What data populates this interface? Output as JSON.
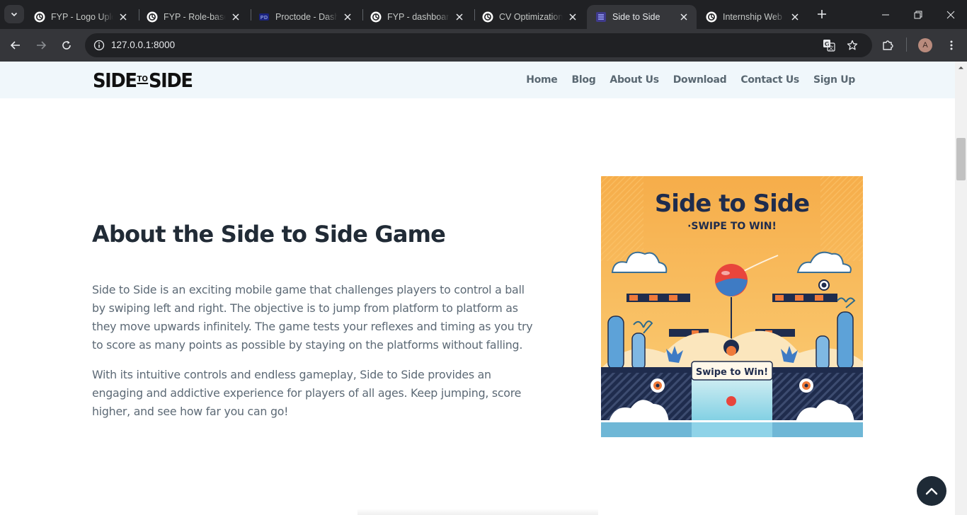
{
  "browser": {
    "tabs": [
      {
        "title": "FYP - Logo Upload",
        "favicon": "chatgpt-icon"
      },
      {
        "title": "FYP - Role-based",
        "favicon": "chatgpt-icon"
      },
      {
        "title": "Proctode - Dashboard",
        "favicon": "proctode-icon"
      },
      {
        "title": "FYP - dashboard",
        "favicon": "chatgpt-icon"
      },
      {
        "title": "CV Optimization",
        "favicon": "chatgpt-icon"
      },
      {
        "title": "Side to Side",
        "favicon": "site-icon",
        "active": true
      },
      {
        "title": "Internship Web Dev",
        "favicon": "chatgpt-icon"
      }
    ],
    "url": "127.0.0.1:8000",
    "profile_initial": "A"
  },
  "site": {
    "logo": {
      "left": "SIDE",
      "middle": "TO",
      "right": "SIDE"
    },
    "nav": [
      "Home",
      "Blog",
      "About Us",
      "Download",
      "Contact Us",
      "Sign Up"
    ]
  },
  "about": {
    "title": "About the Side to Side Game",
    "paragraphs": [
      "Side to Side is an exciting mobile game that challenges players to control a ball by swiping left and right. The objective is to jump from platform to platform as they move upwards infinitely. The game tests your reflexes and timing as you try to score as many points as possible by staying on the platforms without falling.",
      "With its intuitive controls and endless gameplay, Side to Side provides an engaging and addictive experience for players of all ages. Keep jumping, score higher, and see how far you can go!"
    ]
  },
  "poster": {
    "title": "Side to Side",
    "subtitle": "·SWIPE TO WIN!",
    "banner": "Swipe to Win!",
    "colors": {
      "background": "#f7b955",
      "navy": "#1f2c4d",
      "orange": "#ef7a3a",
      "red": "#e8453c",
      "sky": "#8fd3e8"
    }
  },
  "colors": {
    "header_bg": "#f0f7fb",
    "title": "#212b36",
    "body_text": "#5c6975",
    "nav_text": "#5a6872",
    "back_to_top": "#1e2a36"
  }
}
